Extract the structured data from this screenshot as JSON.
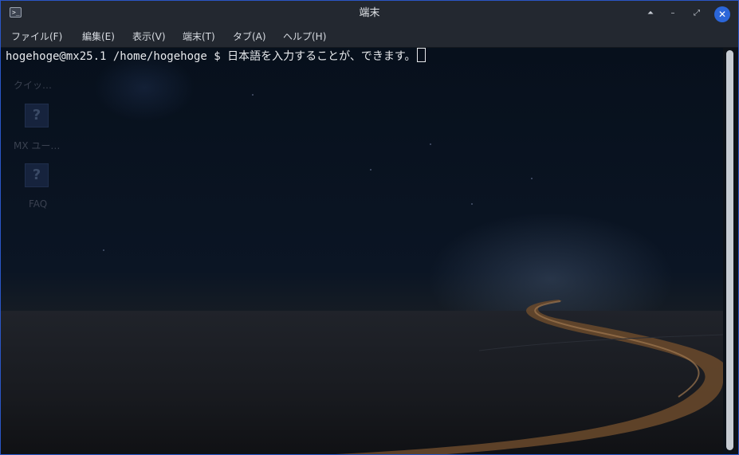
{
  "window": {
    "title": "端末",
    "app_icon": "terminal-icon",
    "app_icon_glyph": ">_",
    "controls": {
      "shade_glyph": "⏶",
      "minimize_glyph": "–",
      "maximize_glyph": "⤢",
      "close_glyph": "✕"
    }
  },
  "menu": {
    "items": [
      "ファイル(F)",
      "編集(E)",
      "表示(V)",
      "端末(T)",
      "タブ(A)",
      "ヘルプ(H)"
    ]
  },
  "terminal": {
    "prompt": "hogehoge@mx25.1 /home/hogehoge $ ",
    "input": "日本語を入力することが、できます。"
  },
  "desktop": {
    "icons": [
      {
        "label": "クイッ…",
        "glyph": ""
      },
      {
        "label": "MX ユー…",
        "glyph": "?"
      },
      {
        "label": "FAQ",
        "glyph": "?"
      }
    ]
  },
  "colors": {
    "accent": "#2b66d9",
    "titlebar": "#232830",
    "text": "#e8eaed"
  }
}
